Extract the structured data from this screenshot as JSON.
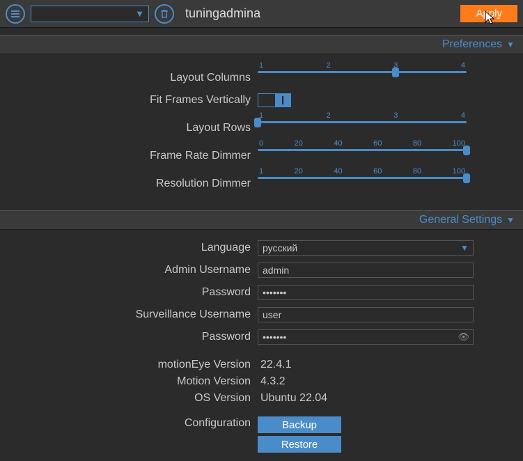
{
  "top": {
    "title": "tuningadmina",
    "apply": "Apply"
  },
  "sections": {
    "preferences": "Preferences",
    "general": "General Settings"
  },
  "prefs": {
    "layout_columns": {
      "label": "Layout Columns",
      "ticks": [
        "1",
        "2",
        "3",
        "4"
      ],
      "pos": 66
    },
    "fit_frames": {
      "label": "Fit Frames Vertically",
      "on": true
    },
    "layout_rows": {
      "label": "Layout Rows",
      "ticks": [
        "1",
        "2",
        "3",
        "4"
      ],
      "pos": 0
    },
    "frame_rate_dimmer": {
      "label": "Frame Rate Dimmer",
      "ticks": [
        "0",
        "20",
        "40",
        "60",
        "80",
        "100"
      ],
      "pos": 100
    },
    "resolution_dimmer": {
      "label": "Resolution Dimmer",
      "ticks": [
        "1",
        "20",
        "40",
        "60",
        "80",
        "100"
      ],
      "pos": 100
    }
  },
  "general": {
    "language": {
      "label": "Language",
      "value": "русский"
    },
    "admin_user": {
      "label": "Admin Username",
      "value": "admin"
    },
    "admin_pass": {
      "label": "Password",
      "value": "•••••••"
    },
    "surv_user": {
      "label": "Surveillance Username",
      "value": "user"
    },
    "surv_pass": {
      "label": "Password",
      "value": "•••••••"
    },
    "me_version": {
      "label": "motionEye Version",
      "value": "22.4.1"
    },
    "motion_version": {
      "label": "Motion Version",
      "value": "4.3.2"
    },
    "os_version": {
      "label": "OS Version",
      "value": "Ubuntu 22.04"
    },
    "configuration": {
      "label": "Configuration",
      "backup": "Backup",
      "restore": "Restore"
    }
  }
}
